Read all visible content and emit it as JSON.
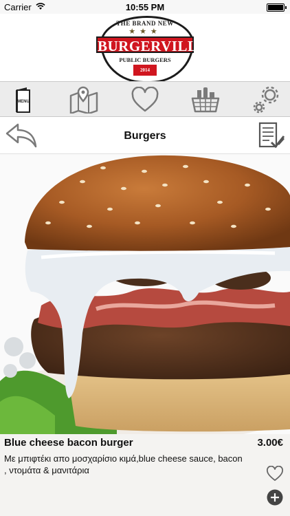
{
  "status_bar": {
    "carrier": "Carrier",
    "time": "10:55 PM"
  },
  "logo": {
    "tagline_top": "THE BRAND NEW",
    "brand": "BURGERVILLE",
    "tagline_bottom": "PUBLIC BURGERS",
    "est": "2014"
  },
  "toolbar": {
    "icons": [
      "menu-icon",
      "map-icon",
      "heart-icon",
      "basket-icon",
      "settings-icon"
    ],
    "menu_icon_label": "MENU"
  },
  "navbar": {
    "title": "Burgers"
  },
  "product": {
    "name": "Blue cheese bacon burger",
    "price": "3.00€",
    "description": "Με μπιφτέκι απο μοσχαρίσιο κιμά,blue cheese sauce, bacon , ντομάτα & μανιτάρια"
  },
  "colors": {
    "brand_red": "#d0161f",
    "toolbar_bg": "#ececec",
    "icon_gray": "#7a7a7a"
  }
}
